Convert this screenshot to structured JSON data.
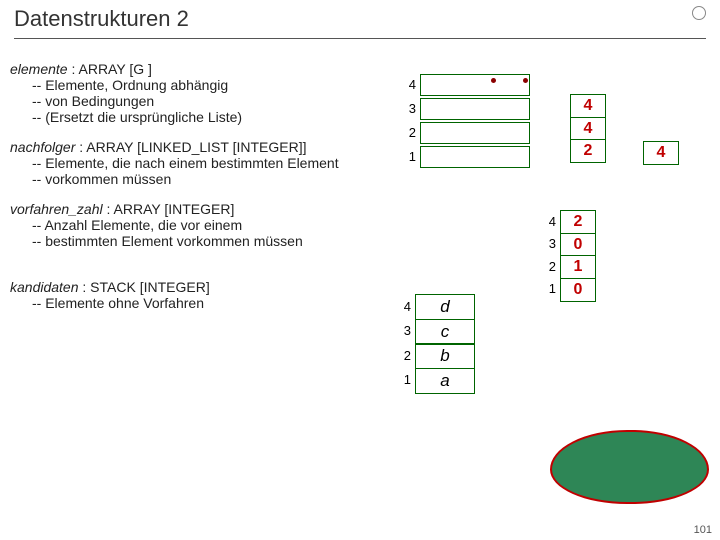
{
  "title": "Datenstrukturen 2",
  "page_number": "101",
  "elemente": {
    "name": "elemente",
    "type": ": ARRAY [G ]",
    "c1": "-- Elemente, Ordnung abhängig",
    "c2": "-- von Bedingungen",
    "c3": "-- (Ersetzt die ursprüngliche Liste)"
  },
  "nachfolger": {
    "name": "nachfolger",
    "type": ": ARRAY [LINKED_LIST [INTEGER]]",
    "c1": "-- Elemente, die nach einem bestimmten Element",
    "c2": "-- vorkommen müssen"
  },
  "vorfahren": {
    "name": "vorfahren_zahl",
    "type": ": ARRAY [INTEGER]",
    "c1": "-- Anzahl Elemente, die vor einem",
    "c2": "-- bestimmten Element vorkommen müssen"
  },
  "kandidaten": {
    "name": "kandidaten",
    "type": ": STACK [INTEGER]",
    "c1": "-- Elemente ohne Vorfahren"
  },
  "diag1": {
    "idx": [
      "4",
      "3",
      "2",
      "1"
    ],
    "col2": [
      "4",
      "4",
      "2"
    ],
    "col3": [
      "4"
    ]
  },
  "diag2": {
    "idx": [
      "4",
      "3",
      "2",
      "1"
    ],
    "vals": [
      "2",
      "0",
      "1",
      "0"
    ]
  },
  "diag3": {
    "idx": [
      "4",
      "3",
      "2",
      "1"
    ],
    "vals": [
      "d",
      "c",
      "b",
      "a"
    ]
  }
}
